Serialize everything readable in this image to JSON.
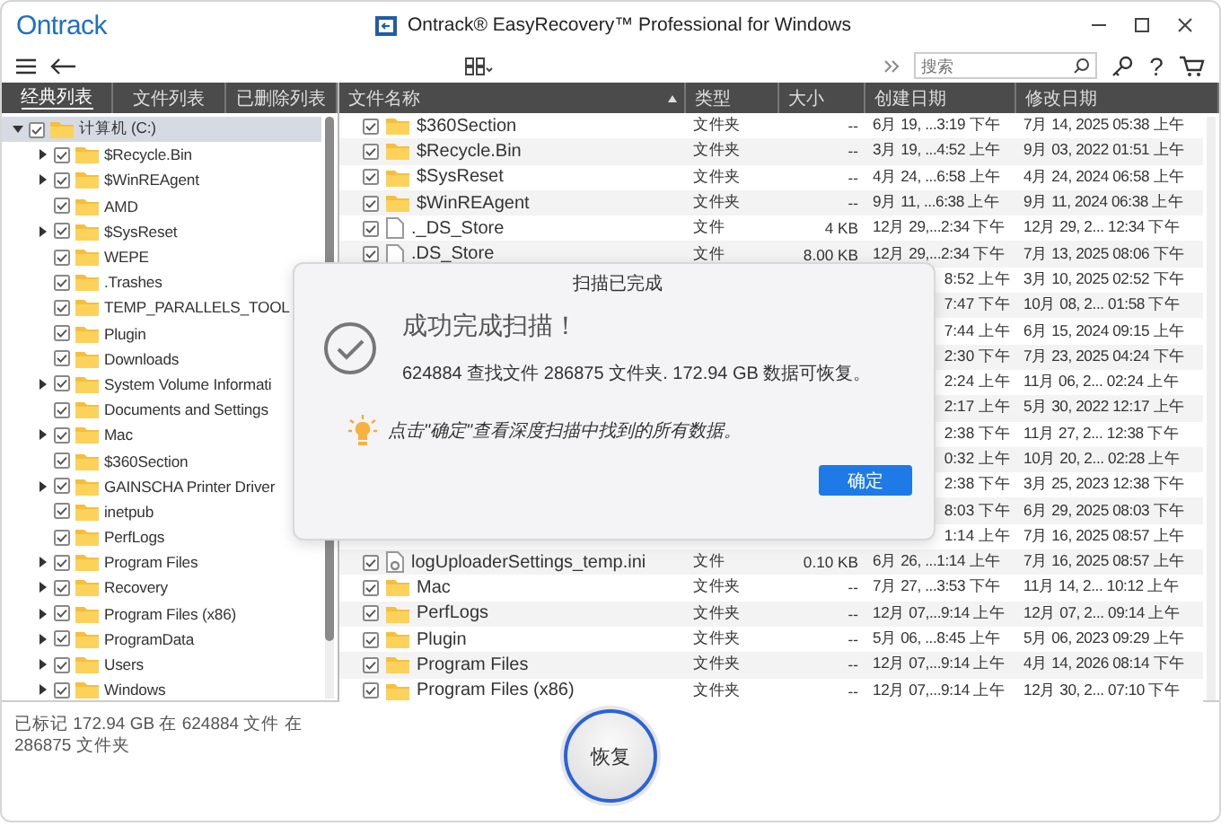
{
  "window": {
    "logo": "Ontrack",
    "title": "Ontrack® EasyRecovery™ Professional for Windows"
  },
  "toolbar": {
    "search": {
      "placeholder": "搜索"
    },
    "help": "?"
  },
  "tabs": [
    {
      "label": "经典列表",
      "selected": true
    },
    {
      "label": "文件列表",
      "selected": false
    },
    {
      "label": "已删除列表",
      "selected": false
    }
  ],
  "tree": {
    "items": [
      {
        "label": "计算机 (C:)",
        "checked": true,
        "expandable": true,
        "expanded": true,
        "selected": true,
        "children": [
          {
            "label": "$Recycle.Bin",
            "checked": true,
            "expandable": true,
            "expanded": false,
            "selected": false
          },
          {
            "label": "$WinREAgent",
            "checked": true,
            "expandable": true,
            "expanded": false,
            "selected": false
          },
          {
            "label": "AMD",
            "checked": true,
            "expandable": false,
            "expanded": false,
            "selected": false
          },
          {
            "label": "$SysReset",
            "checked": true,
            "expandable": true,
            "expanded": false,
            "selected": false
          },
          {
            "label": "WEPE",
            "checked": true,
            "expandable": false,
            "expanded": false,
            "selected": false
          },
          {
            "label": ".Trashes",
            "checked": true,
            "expandable": false,
            "expanded": false,
            "selected": false
          },
          {
            "label": "TEMP_PARALLELS_TOOL",
            "checked": true,
            "expandable": false,
            "expanded": false,
            "selected": false
          },
          {
            "label": "Plugin",
            "checked": true,
            "expandable": false,
            "expanded": false,
            "selected": false
          },
          {
            "label": "Downloads",
            "checked": true,
            "expandable": false,
            "expanded": false,
            "selected": false
          },
          {
            "label": "System Volume Informati",
            "checked": true,
            "expandable": true,
            "expanded": false,
            "selected": false
          },
          {
            "label": "Documents and Settings",
            "checked": true,
            "expandable": false,
            "expanded": false,
            "selected": false
          },
          {
            "label": "Mac",
            "checked": true,
            "expandable": true,
            "expanded": false,
            "selected": false
          },
          {
            "label": "$360Section",
            "checked": true,
            "expandable": false,
            "expanded": false,
            "selected": false
          },
          {
            "label": "GAINSCHA Printer Driver",
            "checked": true,
            "expandable": true,
            "expanded": false,
            "selected": false
          },
          {
            "label": "inetpub",
            "checked": true,
            "expandable": false,
            "expanded": false,
            "selected": false
          },
          {
            "label": "PerfLogs",
            "checked": true,
            "expandable": false,
            "expanded": false,
            "selected": false
          },
          {
            "label": "Program Files",
            "checked": true,
            "expandable": true,
            "expanded": false,
            "selected": false
          },
          {
            "label": "Recovery",
            "checked": true,
            "expandable": true,
            "expanded": false,
            "selected": false
          },
          {
            "label": "Program Files (x86)",
            "checked": true,
            "expandable": true,
            "expanded": false,
            "selected": false
          },
          {
            "label": "ProgramData",
            "checked": true,
            "expandable": true,
            "expanded": false,
            "selected": false
          },
          {
            "label": "Users",
            "checked": true,
            "expandable": true,
            "expanded": false,
            "selected": false
          },
          {
            "label": "Windows",
            "checked": true,
            "expandable": true,
            "expanded": false,
            "selected": false
          }
        ]
      }
    ]
  },
  "table": {
    "columns": [
      "文件名称",
      "类型",
      "大小",
      "创建日期",
      "修改日期"
    ],
    "rows": [
      {
        "kind": "folder",
        "checked": true,
        "name": "$360Section",
        "type": "文件夹",
        "size": "--",
        "created": "6月 19, ...3:19 下午",
        "modified": "7月 14, 2025 05:38 上午"
      },
      {
        "kind": "folder",
        "checked": true,
        "name": "$Recycle.Bin",
        "type": "文件夹",
        "size": "--",
        "created": "3月 19, ...4:52 上午",
        "modified": "9月 03, 2022 01:51 上午"
      },
      {
        "kind": "folder",
        "checked": true,
        "name": "$SysReset",
        "type": "文件夹",
        "size": "--",
        "created": "4月 24, ...6:58 上午",
        "modified": "4月 24, 2024 06:58 上午"
      },
      {
        "kind": "folder",
        "checked": true,
        "name": "$WinREAgent",
        "type": "文件夹",
        "size": "--",
        "created": "9月 11, ...6:38 上午",
        "modified": "9月 11, 2024 06:38 上午"
      },
      {
        "kind": "file",
        "checked": true,
        "name": "._DS_Store",
        "type": "文件",
        "size": "4 KB",
        "created": "12月 29,...2:34 下午",
        "modified": "12月 29, 2... 12:34 下午"
      },
      {
        "kind": "file",
        "checked": true,
        "name": ".DS_Store",
        "type": "文件",
        "size": "8.00 KB",
        "created": "12月 29,...2:34 下午",
        "modified": "7月 13, 2025 08:06 下午"
      },
      {
        "kind": "covered",
        "created": "8:52 上午",
        "modified": "3月 10, 2025 02:52 下午"
      },
      {
        "kind": "covered",
        "created": "7:47 下午",
        "modified": "10月 08, 2... 01:58 下午"
      },
      {
        "kind": "covered",
        "created": "7:44 上午",
        "modified": "6月 15, 2024 09:15 上午"
      },
      {
        "kind": "covered",
        "created": "2:30 下午",
        "modified": "7月 23, 2025 04:24 下午"
      },
      {
        "kind": "covered",
        "created": "2:24 上午",
        "modified": "11月 06, 2... 02:24 上午"
      },
      {
        "kind": "covered",
        "created": "2:17 上午",
        "modified": "5月 30, 2022 12:17 上午"
      },
      {
        "kind": "covered",
        "created": "2:38 下午",
        "modified": "11月 27, 2... 12:38 下午"
      },
      {
        "kind": "covered",
        "created": "0:32 上午",
        "modified": "10月 20, 2... 02:28 上午"
      },
      {
        "kind": "covered",
        "created": "2:38 下午",
        "modified": "3月 25, 2023 12:38 下午"
      },
      {
        "kind": "covered",
        "created": "8:03 下午",
        "modified": "6月 29, 2025 08:03 下午"
      },
      {
        "kind": "covered",
        "created": "1:14 上午",
        "modified": "7月 16, 2025 08:57 上午"
      },
      {
        "kind": "settings-file",
        "checked": true,
        "name": "logUploaderSettings_temp.ini",
        "type": "文件",
        "size": "0.10 KB",
        "created": "6月 26, ...1:14 上午",
        "modified": "7月 16, 2025 08:57 上午"
      },
      {
        "kind": "folder",
        "checked": true,
        "name": "Mac",
        "type": "文件夹",
        "size": "--",
        "created": "7月 27, ...3:53 下午",
        "modified": "11月 14, 2... 10:12 上午"
      },
      {
        "kind": "folder",
        "checked": true,
        "name": "PerfLogs",
        "type": "文件夹",
        "size": "--",
        "created": "12月 07,...9:14 上午",
        "modified": "12月 07, 2... 09:14 上午"
      },
      {
        "kind": "folder",
        "checked": true,
        "name": "Plugin",
        "type": "文件夹",
        "size": "--",
        "created": "5月 06, ...8:45 上午",
        "modified": "5月 06, 2023 09:29 上午"
      },
      {
        "kind": "folder",
        "checked": true,
        "name": "Program Files",
        "type": "文件夹",
        "size": "--",
        "created": "12月 07,...9:14 上午",
        "modified": "4月 14, 2026 08:14 下午"
      },
      {
        "kind": "folder",
        "checked": true,
        "name": "Program Files (x86)",
        "type": "文件夹",
        "size": "--",
        "created": "12月 07,...9:14 上午",
        "modified": "12月 30, 2... 07:10 下午"
      }
    ]
  },
  "dialog": {
    "title": "扫描已完成",
    "heading": "成功完成扫描！",
    "message": "624884 查找文件 286875 文件夹. 172.94 GB 数据可恢复。",
    "hint": "点击\"确定\"查看深度扫描中找到的所有数据。",
    "button": "确定"
  },
  "status_bar": {
    "lines": [
      "已标记 172.94 GB 在 624884 文件 在",
      "286875 文件夹"
    ],
    "button": "恢复"
  }
}
